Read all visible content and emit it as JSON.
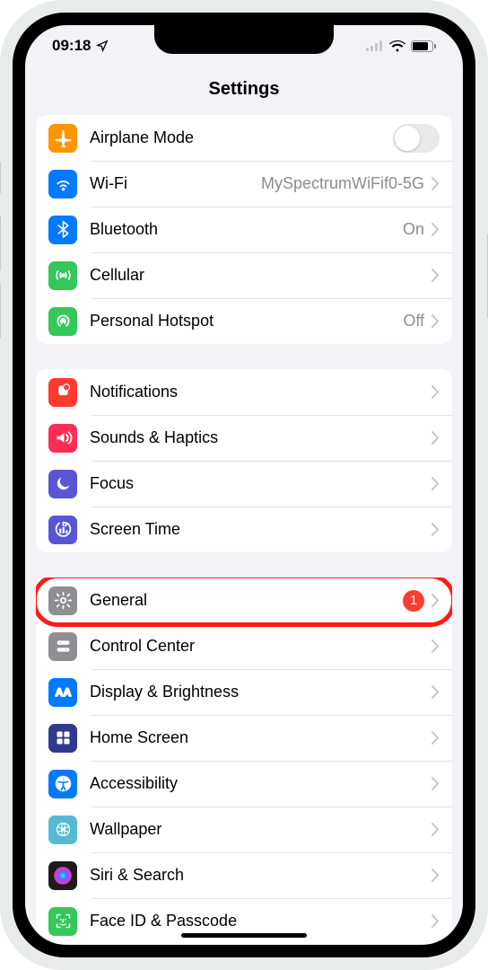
{
  "statusbar": {
    "time": "09:18"
  },
  "page_title": "Settings",
  "groups": [
    {
      "rows": [
        {
          "icon": "airplane",
          "bg": "#ff9500",
          "label": "Airplane Mode",
          "kind": "toggle"
        },
        {
          "icon": "wifi",
          "bg": "#007aff",
          "label": "Wi-Fi",
          "value": "MySpectrumWiFif0-5G",
          "kind": "link"
        },
        {
          "icon": "bluetooth",
          "bg": "#007aff",
          "label": "Bluetooth",
          "value": "On",
          "kind": "link"
        },
        {
          "icon": "cellular",
          "bg": "#34c759",
          "label": "Cellular",
          "kind": "link"
        },
        {
          "icon": "hotspot",
          "bg": "#34c759",
          "label": "Personal Hotspot",
          "value": "Off",
          "kind": "link"
        }
      ]
    },
    {
      "rows": [
        {
          "icon": "notifications",
          "bg": "#ff3b30",
          "label": "Notifications",
          "kind": "link"
        },
        {
          "icon": "sounds",
          "bg": "#ff2d55",
          "label": "Sounds & Haptics",
          "kind": "link"
        },
        {
          "icon": "focus",
          "bg": "#5856d6",
          "label": "Focus",
          "kind": "link"
        },
        {
          "icon": "screentime",
          "bg": "#5856d6",
          "label": "Screen Time",
          "kind": "link"
        }
      ]
    },
    {
      "rows": [
        {
          "icon": "general",
          "bg": "#8e8e93",
          "label": "General",
          "badge": "1",
          "kind": "link",
          "highlight": true
        },
        {
          "icon": "controlcenter",
          "bg": "#8e8e93",
          "label": "Control Center",
          "kind": "link"
        },
        {
          "icon": "display",
          "bg": "#007aff",
          "label": "Display & Brightness",
          "kind": "link"
        },
        {
          "icon": "homescreen",
          "bg": "#2f3a8f",
          "label": "Home Screen",
          "kind": "link"
        },
        {
          "icon": "accessibility",
          "bg": "#007aff",
          "label": "Accessibility",
          "kind": "link"
        },
        {
          "icon": "wallpaper",
          "bg": "#54bad1",
          "label": "Wallpaper",
          "kind": "link"
        },
        {
          "icon": "siri",
          "bg": "#1c1c1e",
          "label": "Siri & Search",
          "kind": "link"
        },
        {
          "icon": "faceid",
          "bg": "#34c759",
          "label": "Face ID & Passcode",
          "kind": "link"
        }
      ]
    }
  ]
}
